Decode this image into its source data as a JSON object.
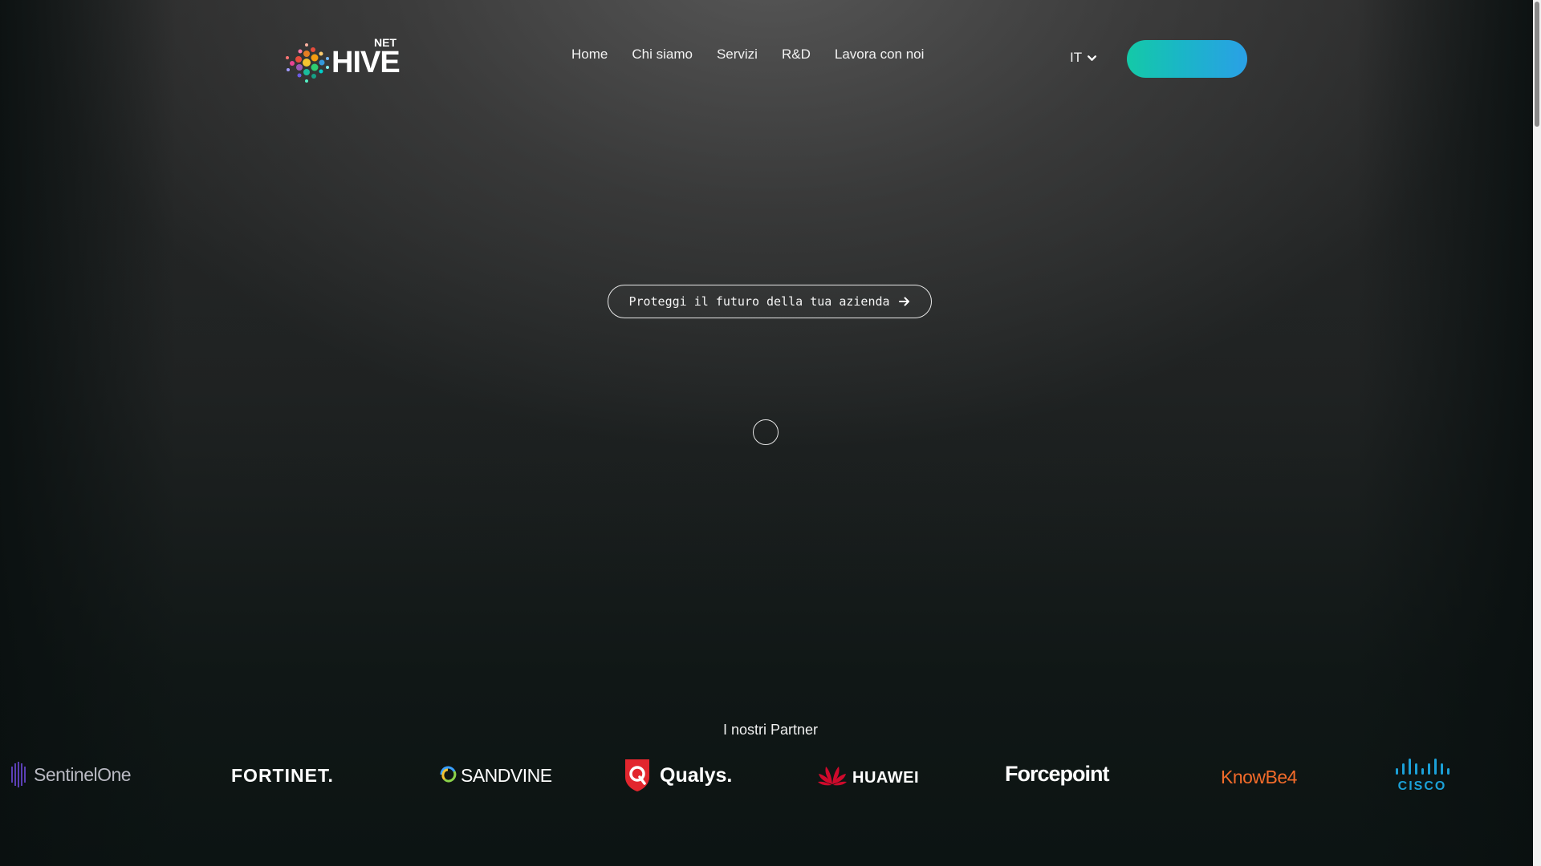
{
  "header": {
    "logo": {
      "small_text": "NET",
      "big_text": "HIVE"
    },
    "nav": [
      {
        "label": "Home"
      },
      {
        "label": "Chi siamo"
      },
      {
        "label": "Servizi"
      },
      {
        "label": "R&D"
      },
      {
        "label": "Lavora con noi"
      }
    ],
    "language": "IT",
    "cta_label": ""
  },
  "hero": {
    "button_label": "Proteggi il futuro della tua azienda"
  },
  "partners": {
    "title": "I nostri Partner",
    "logos": [
      {
        "name": "SentinelOne",
        "text": "SentinelOne",
        "color": "#b9b9c2"
      },
      {
        "name": "Fortinet",
        "text": "FORTINET.",
        "color": "#ffffff"
      },
      {
        "name": "Sandvine",
        "text": "SANDVINE",
        "color": "#ffffff"
      },
      {
        "name": "Qualys",
        "text": "Qualys.",
        "color": "#ffffff"
      },
      {
        "name": "Huawei",
        "text": "HUAWEI",
        "color": "#ffffff"
      },
      {
        "name": "Forcepoint",
        "text": "Forcepoint",
        "color": "#ffffff"
      },
      {
        "name": "KnowBe4",
        "text": "KnowBe4",
        "color": "#f26b2a"
      },
      {
        "name": "Cisco",
        "text": "CISCO",
        "color": "#1ba0d7"
      }
    ]
  },
  "colors": {
    "cta_start": "#14c9a7",
    "cta_end": "#2aa0e6",
    "qualys_red": "#e2262e",
    "huawei_red": "#cf0a2c",
    "cisco_blue": "#1ba0d7",
    "knowbe4_orange": "#f26b2a"
  }
}
